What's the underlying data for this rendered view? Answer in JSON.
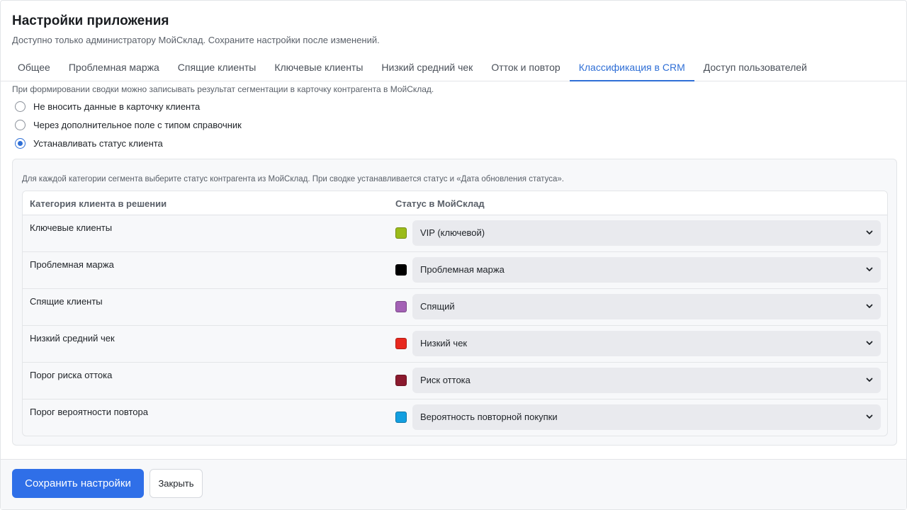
{
  "header": {
    "title": "Настройки приложения",
    "subtitle": "Доступно только администратору МойСклад. Сохраните настройки после изменений."
  },
  "tabs": [
    {
      "label": "Общее",
      "active": false
    },
    {
      "label": "Проблемная маржа",
      "active": false
    },
    {
      "label": "Спящие клиенты",
      "active": false
    },
    {
      "label": "Ключевые клиенты",
      "active": false
    },
    {
      "label": "Низкий средний чек",
      "active": false
    },
    {
      "label": "Отток и повтор",
      "active": false
    },
    {
      "label": "Классификация в CRM",
      "active": true
    },
    {
      "label": "Доступ пользователей",
      "active": false
    }
  ],
  "crm": {
    "hint": "При формировании сводки можно записывать результат сегментации в карточку контрагента в МойСклад.",
    "options": [
      {
        "label": "Не вносить данные в карточку клиента",
        "checked": false
      },
      {
        "label": "Через дополнительное поле с типом справочник",
        "checked": false
      },
      {
        "label": "Устанавливать статус клиента",
        "checked": true
      }
    ],
    "panel_hint": "Для каждой категории сегмента выберите статус контрагента из МойСклад. При сводке устанавливается статус и «Дата обновления статуса».",
    "table": {
      "col_category": "Категория клиента в решении",
      "col_status": "Статус в МойСклад",
      "rows": [
        {
          "category": "Ключевые клиенты",
          "status": "VIP (ключевой)",
          "color": "#9bbb19"
        },
        {
          "category": "Проблемная маржа",
          "status": "Проблемная маржа",
          "color": "#000000"
        },
        {
          "category": "Спящие клиенты",
          "status": "Спящий",
          "color": "#a361b5"
        },
        {
          "category": "Низкий средний чек",
          "status": "Низкий чек",
          "color": "#e8281e"
        },
        {
          "category": "Порог риска оттока",
          "status": "Риск оттока",
          "color": "#8b1a2e"
        },
        {
          "category": "Порог вероятности повтора",
          "status": "Вероятность повторной покупки",
          "color": "#139fe0"
        }
      ]
    }
  },
  "footer": {
    "save_label": "Сохранить настройки",
    "close_label": "Закрыть"
  },
  "colors": {
    "accent": "#2f6fd6",
    "primary_button": "#2f6fe8"
  }
}
